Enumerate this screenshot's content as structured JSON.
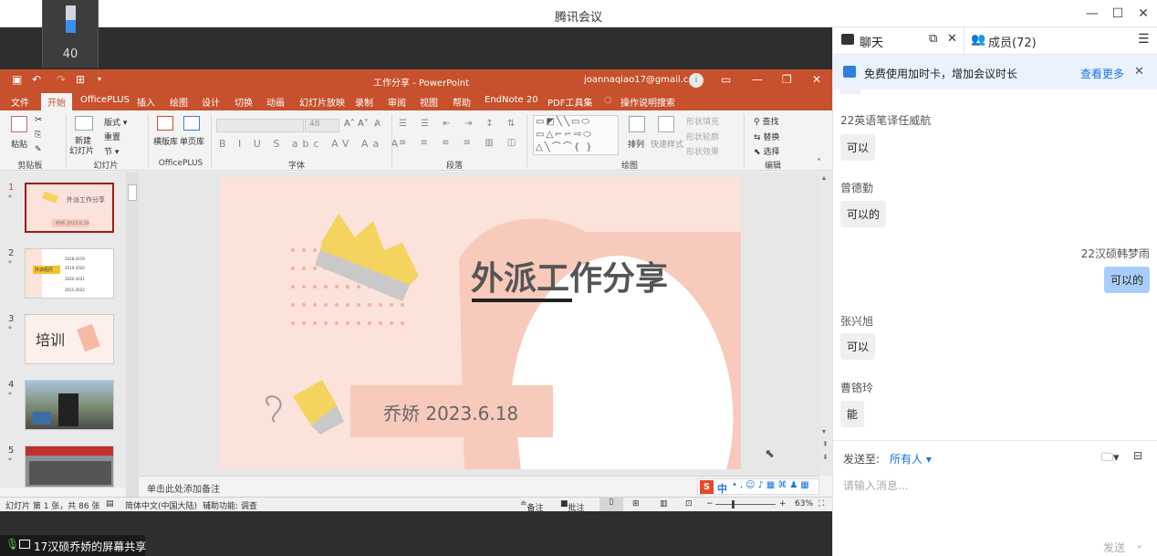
{
  "app": {
    "title": "腾讯会议"
  },
  "video_tile": {
    "level": 40,
    "label": "40"
  },
  "ppt": {
    "doc_title": "工作分享 - PowerPoint",
    "account": "joannaqiao17@gmail.com",
    "avatar_letter": "i",
    "tabs": [
      "文件",
      "开始",
      "OfficePLUS",
      "插入",
      "绘图",
      "设计",
      "切换",
      "动画",
      "幻灯片放映",
      "录制",
      "审阅",
      "视图",
      "帮助",
      "EndNote 20",
      "PDF工具集",
      "操作说明搜索"
    ],
    "active_tab": "开始",
    "ribbon": {
      "paste": "粘贴",
      "clipboard": "剪贴板",
      "new_slide_1": "新建",
      "new_slide_2": "幻灯片",
      "layout": "版式",
      "reset": "重置",
      "section": "节",
      "slides_group": "幻灯片",
      "landscape": "横版库",
      "single_page": "单页库",
      "officeplus_group": "OfficePLUS",
      "font_size": "48",
      "font_group": "字体",
      "paragraph_group": "段落",
      "arrange": "排列",
      "quick_styles": "快速样式",
      "shape_fill": "形状填充",
      "shape_outline": "形状轮廓",
      "shape_effects": "形状效果",
      "drawing_group": "绘图",
      "find": "查找",
      "replace": "替换",
      "select": "选择",
      "editing_group": "编辑"
    },
    "thumbnails": [
      {
        "num": "1",
        "text": "外派工作分享",
        "sub": "乔娇 2023.6.18"
      },
      {
        "num": "2",
        "label": "外派经历",
        "rows": [
          "2018-2019",
          "2019-2020",
          "2020-2021",
          "2021-2022"
        ]
      },
      {
        "num": "3",
        "text": "培训"
      },
      {
        "num": "4"
      },
      {
        "num": "5"
      }
    ],
    "slide": {
      "title": "外派工作分享",
      "subtitle": "乔娇 2023.6.18"
    },
    "notes_placeholder": "单击此处添加备注",
    "status": {
      "slide_info": "幻灯片 第 1 张，共 86 张",
      "language": "简体中文(中国大陆)",
      "accessibility": "辅助功能: 调查",
      "notes": "备注",
      "comments": "批注",
      "zoom": "63%"
    },
    "ime": {
      "lang": "中"
    }
  },
  "share_label": "17汉硕乔娇的屏幕共享",
  "chat_panel": {
    "tab_chat": "聊天",
    "tab_members": "成员(72)",
    "banner_text": "免费使用加时卡，增加会议时长",
    "banner_link": "查看更多",
    "messages": [
      {
        "sender": "22英语笔译任威航",
        "text": "可以",
        "self": false
      },
      {
        "sender": "曾德勤",
        "text": "可以的",
        "self": false
      },
      {
        "sender": "22汉硕韩梦雨",
        "text": "可以的",
        "self": true
      },
      {
        "sender": "张兴旭",
        "text": "可以",
        "self": false
      },
      {
        "sender": "曹铬玲",
        "text": "能",
        "self": false
      }
    ],
    "send_to_label": "发送至:",
    "send_to_value": "所有人",
    "input_placeholder": "请输入消息...",
    "send_label": "发送"
  },
  "colors": {
    "ppt_accent": "#c7502d",
    "tencent_blue": "#1a73e8",
    "self_bubble": "#a9cdf9"
  }
}
